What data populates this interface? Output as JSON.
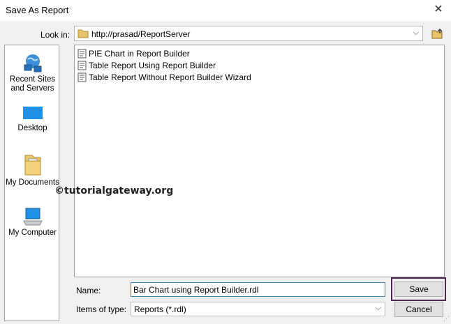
{
  "window": {
    "title": "Save As Report",
    "close_glyph": "✕"
  },
  "lookin": {
    "label": "Look in:",
    "value": "http://prasad/ReportServer",
    "folder_icon": "folder-icon",
    "up_icon": "up-folder-icon"
  },
  "places": [
    {
      "label": "Recent Sites and Servers",
      "icon": "network-icon"
    },
    {
      "label": "Desktop",
      "icon": "desktop-icon"
    },
    {
      "label": "My Documents",
      "icon": "documents-folder-icon"
    },
    {
      "label": "My Computer",
      "icon": "computer-icon"
    }
  ],
  "files": [
    {
      "name": "PIE Chart in Report Builder",
      "icon": "report-file-icon"
    },
    {
      "name": "Table Report Using Report Builder",
      "icon": "report-file-icon"
    },
    {
      "name": "Table Report Without Report Builder Wizard",
      "icon": "report-file-icon"
    }
  ],
  "watermark": "©tutorialgateway.org",
  "name_field": {
    "label": "Name:",
    "value": "Bar Chart using Report Builder.rdl"
  },
  "type_field": {
    "label": "Items of type:",
    "value": "Reports (*.rdl)"
  },
  "buttons": {
    "save": "Save",
    "cancel": "Cancel"
  },
  "colors": {
    "highlight_outline": "#4a2b4e",
    "input_focus": "#3c7fb1"
  }
}
